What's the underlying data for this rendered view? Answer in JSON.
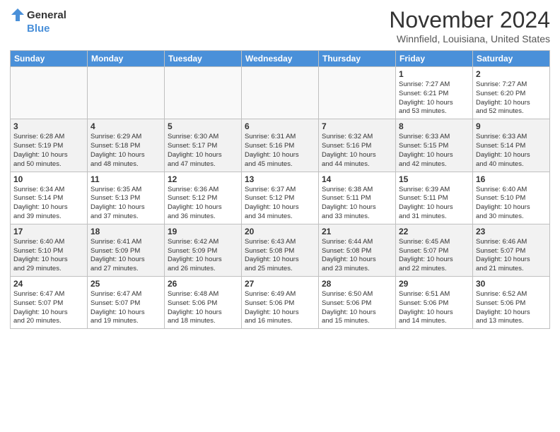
{
  "header": {
    "logo_general": "General",
    "logo_blue": "Blue",
    "month_title": "November 2024",
    "location": "Winnfield, Louisiana, United States"
  },
  "weekdays": [
    "Sunday",
    "Monday",
    "Tuesday",
    "Wednesday",
    "Thursday",
    "Friday",
    "Saturday"
  ],
  "weeks": [
    [
      {
        "day": "",
        "info": ""
      },
      {
        "day": "",
        "info": ""
      },
      {
        "day": "",
        "info": ""
      },
      {
        "day": "",
        "info": ""
      },
      {
        "day": "",
        "info": ""
      },
      {
        "day": "1",
        "info": "Sunrise: 7:27 AM\nSunset: 6:21 PM\nDaylight: 10 hours\nand 53 minutes."
      },
      {
        "day": "2",
        "info": "Sunrise: 7:27 AM\nSunset: 6:20 PM\nDaylight: 10 hours\nand 52 minutes."
      }
    ],
    [
      {
        "day": "3",
        "info": "Sunrise: 6:28 AM\nSunset: 5:19 PM\nDaylight: 10 hours\nand 50 minutes."
      },
      {
        "day": "4",
        "info": "Sunrise: 6:29 AM\nSunset: 5:18 PM\nDaylight: 10 hours\nand 48 minutes."
      },
      {
        "day": "5",
        "info": "Sunrise: 6:30 AM\nSunset: 5:17 PM\nDaylight: 10 hours\nand 47 minutes."
      },
      {
        "day": "6",
        "info": "Sunrise: 6:31 AM\nSunset: 5:16 PM\nDaylight: 10 hours\nand 45 minutes."
      },
      {
        "day": "7",
        "info": "Sunrise: 6:32 AM\nSunset: 5:16 PM\nDaylight: 10 hours\nand 44 minutes."
      },
      {
        "day": "8",
        "info": "Sunrise: 6:33 AM\nSunset: 5:15 PM\nDaylight: 10 hours\nand 42 minutes."
      },
      {
        "day": "9",
        "info": "Sunrise: 6:33 AM\nSunset: 5:14 PM\nDaylight: 10 hours\nand 40 minutes."
      }
    ],
    [
      {
        "day": "10",
        "info": "Sunrise: 6:34 AM\nSunset: 5:14 PM\nDaylight: 10 hours\nand 39 minutes."
      },
      {
        "day": "11",
        "info": "Sunrise: 6:35 AM\nSunset: 5:13 PM\nDaylight: 10 hours\nand 37 minutes."
      },
      {
        "day": "12",
        "info": "Sunrise: 6:36 AM\nSunset: 5:12 PM\nDaylight: 10 hours\nand 36 minutes."
      },
      {
        "day": "13",
        "info": "Sunrise: 6:37 AM\nSunset: 5:12 PM\nDaylight: 10 hours\nand 34 minutes."
      },
      {
        "day": "14",
        "info": "Sunrise: 6:38 AM\nSunset: 5:11 PM\nDaylight: 10 hours\nand 33 minutes."
      },
      {
        "day": "15",
        "info": "Sunrise: 6:39 AM\nSunset: 5:11 PM\nDaylight: 10 hours\nand 31 minutes."
      },
      {
        "day": "16",
        "info": "Sunrise: 6:40 AM\nSunset: 5:10 PM\nDaylight: 10 hours\nand 30 minutes."
      }
    ],
    [
      {
        "day": "17",
        "info": "Sunrise: 6:40 AM\nSunset: 5:10 PM\nDaylight: 10 hours\nand 29 minutes."
      },
      {
        "day": "18",
        "info": "Sunrise: 6:41 AM\nSunset: 5:09 PM\nDaylight: 10 hours\nand 27 minutes."
      },
      {
        "day": "19",
        "info": "Sunrise: 6:42 AM\nSunset: 5:09 PM\nDaylight: 10 hours\nand 26 minutes."
      },
      {
        "day": "20",
        "info": "Sunrise: 6:43 AM\nSunset: 5:08 PM\nDaylight: 10 hours\nand 25 minutes."
      },
      {
        "day": "21",
        "info": "Sunrise: 6:44 AM\nSunset: 5:08 PM\nDaylight: 10 hours\nand 23 minutes."
      },
      {
        "day": "22",
        "info": "Sunrise: 6:45 AM\nSunset: 5:07 PM\nDaylight: 10 hours\nand 22 minutes."
      },
      {
        "day": "23",
        "info": "Sunrise: 6:46 AM\nSunset: 5:07 PM\nDaylight: 10 hours\nand 21 minutes."
      }
    ],
    [
      {
        "day": "24",
        "info": "Sunrise: 6:47 AM\nSunset: 5:07 PM\nDaylight: 10 hours\nand 20 minutes."
      },
      {
        "day": "25",
        "info": "Sunrise: 6:47 AM\nSunset: 5:07 PM\nDaylight: 10 hours\nand 19 minutes."
      },
      {
        "day": "26",
        "info": "Sunrise: 6:48 AM\nSunset: 5:06 PM\nDaylight: 10 hours\nand 18 minutes."
      },
      {
        "day": "27",
        "info": "Sunrise: 6:49 AM\nSunset: 5:06 PM\nDaylight: 10 hours\nand 16 minutes."
      },
      {
        "day": "28",
        "info": "Sunrise: 6:50 AM\nSunset: 5:06 PM\nDaylight: 10 hours\nand 15 minutes."
      },
      {
        "day": "29",
        "info": "Sunrise: 6:51 AM\nSunset: 5:06 PM\nDaylight: 10 hours\nand 14 minutes."
      },
      {
        "day": "30",
        "info": "Sunrise: 6:52 AM\nSunset: 5:06 PM\nDaylight: 10 hours\nand 13 minutes."
      }
    ]
  ]
}
